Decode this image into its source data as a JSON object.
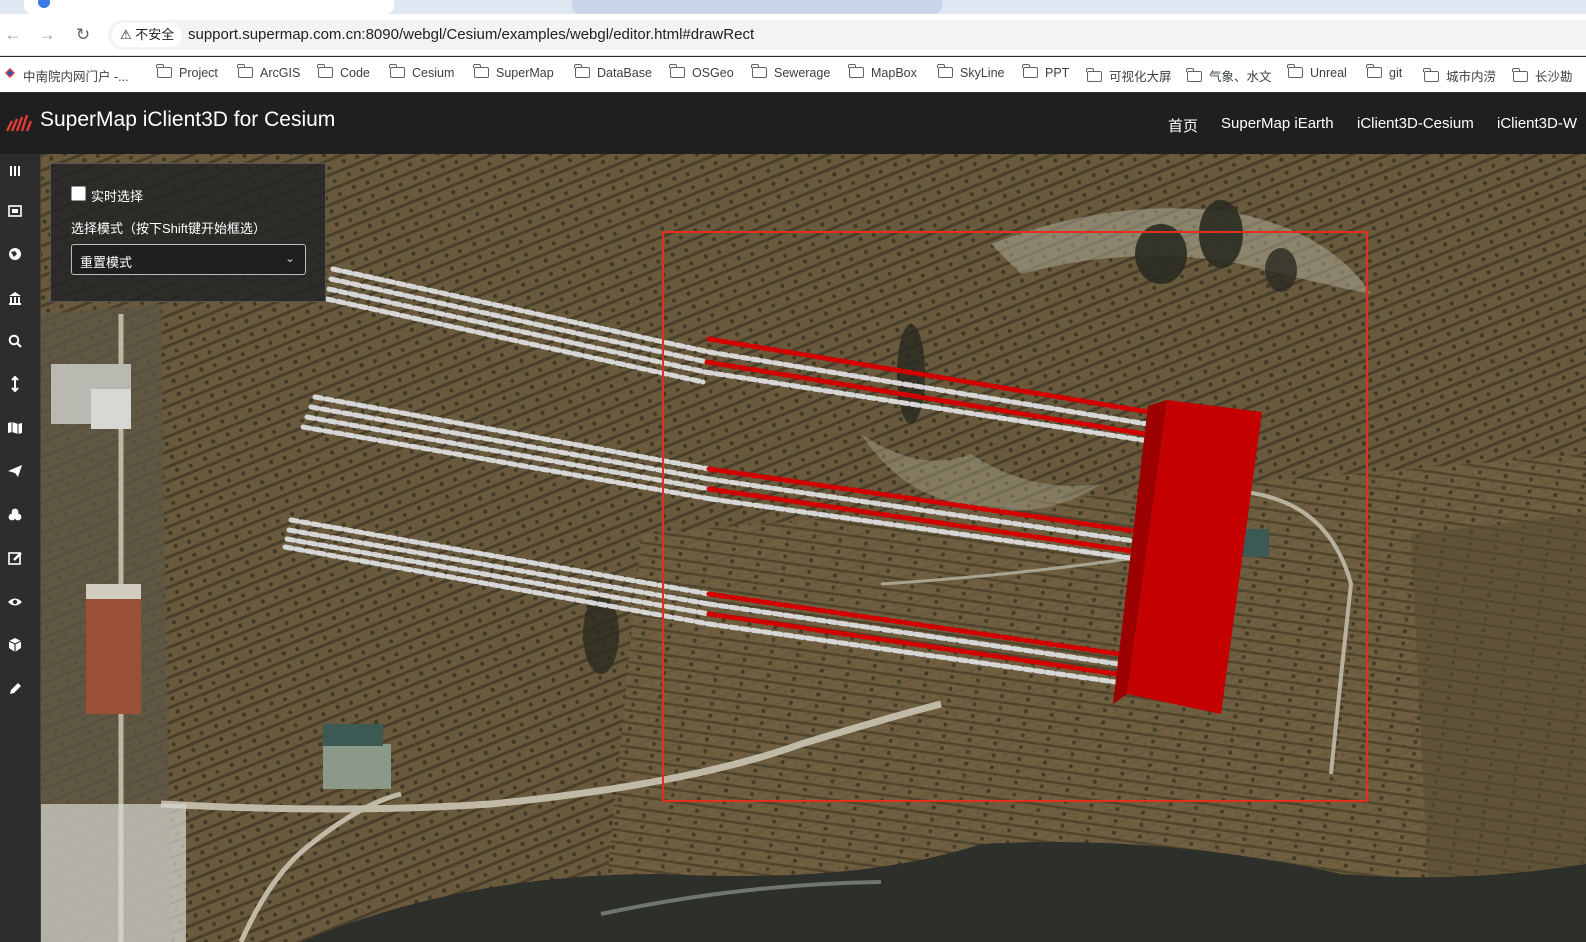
{
  "browser": {
    "insecure_label": "不安全",
    "url": "support.supermap.com.cn:8090/webgl/Cesium/examples/webgl/editor.html#drawRect",
    "bookmarks": [
      {
        "label": "中南院内网门户 -...",
        "folder": false
      },
      {
        "label": "Project",
        "folder": true
      },
      {
        "label": "ArcGIS",
        "folder": true
      },
      {
        "label": "Code",
        "folder": true
      },
      {
        "label": "Cesium",
        "folder": true
      },
      {
        "label": "SuperMap",
        "folder": true
      },
      {
        "label": "DataBase",
        "folder": true
      },
      {
        "label": "OSGeo",
        "folder": true
      },
      {
        "label": "Sewerage",
        "folder": true
      },
      {
        "label": "MapBox",
        "folder": true
      },
      {
        "label": "SkyLine",
        "folder": true
      },
      {
        "label": "PPT",
        "folder": true
      },
      {
        "label": "可视化大屏",
        "folder": true
      },
      {
        "label": "气象、水文",
        "folder": true
      },
      {
        "label": "Unreal",
        "folder": true
      },
      {
        "label": "git",
        "folder": true
      },
      {
        "label": "城市内涝",
        "folder": true
      },
      {
        "label": "长沙勘",
        "folder": true
      }
    ]
  },
  "app": {
    "title": "SuperMap iClient3D for Cesium",
    "nav": [
      "首页",
      "SuperMap iEarth",
      "iClient3D-Cesium",
      "iClient3D-W"
    ],
    "accent": "#e53935"
  },
  "sidebar_icons": [
    "layers-icon",
    "scene-icon",
    "globe-icon",
    "library-icon",
    "search-icon",
    "measure-icon",
    "map-icon",
    "fly-icon",
    "analysis-icon",
    "edit-icon",
    "visibility-icon",
    "model-icon",
    "draw-icon"
  ],
  "panel": {
    "realtime_label": "实时选择",
    "realtime_checked": false,
    "mode_label": "选择模式（按下Shift键开始框选）",
    "mode_value": "重置模式"
  },
  "map": {
    "selection_color": "#e52e1e",
    "selected_color": "#d40000",
    "unselected_color": "#d6d6d6"
  }
}
